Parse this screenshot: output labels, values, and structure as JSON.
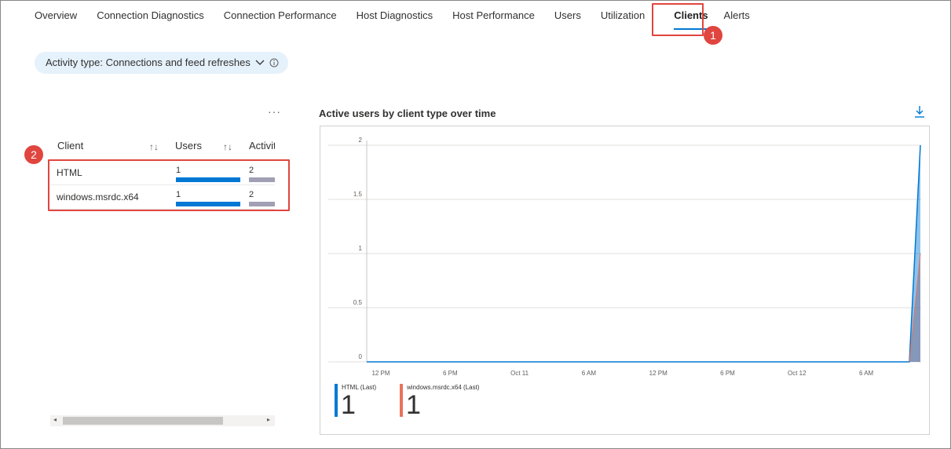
{
  "tabs": [
    "Overview",
    "Connection Diagnostics",
    "Connection Performance",
    "Host Diagnostics",
    "Host Performance",
    "Users",
    "Utilization",
    "Clients",
    "Alerts"
  ],
  "active_tab": "Clients",
  "annotations": [
    "1",
    "2"
  ],
  "filter": {
    "label": "Activity type: Connections and feed refreshes"
  },
  "table": {
    "more": "···",
    "columns": [
      "Client",
      "Users",
      "Activiti"
    ],
    "sort_glyph": "↑↓",
    "rows": [
      {
        "client": "HTML",
        "users": "1",
        "activities": "2"
      },
      {
        "client": "windows.msrdc.x64",
        "users": "1",
        "activities": "2"
      }
    ],
    "scroll_left": "◂",
    "scroll_right": "▸"
  },
  "chart_title": "Active users by client type over time",
  "chart_data": {
    "type": "area",
    "title": "Active users by client type over time",
    "x_tick_labels": [
      "12 PM",
      "6 PM",
      "Oct 11",
      "6 AM",
      "12 PM",
      "6 PM",
      "Oct 12",
      "6 AM"
    ],
    "y_tick_labels": [
      "2",
      "1.5",
      "1",
      "0.5",
      "0"
    ],
    "ylim": [
      0,
      2
    ],
    "series": [
      {
        "name": "HTML (Last)",
        "color": "#0078d4",
        "last_value": "1"
      },
      {
        "name": "windows.msrdc.x64 (Last)",
        "color": "#e8735b",
        "last_value": "1"
      }
    ]
  },
  "colors": {
    "accent": "#0078d4",
    "annotation": "#e0453f",
    "pill_bg": "#e5f1fb"
  }
}
